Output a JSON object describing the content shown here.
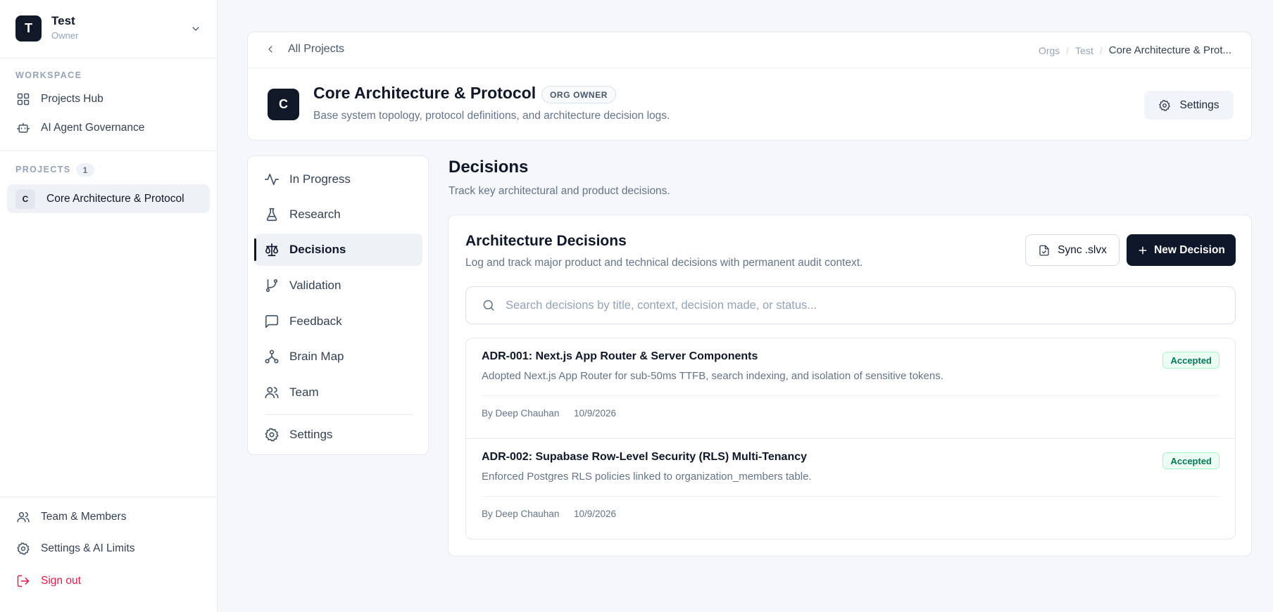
{
  "org": {
    "avatar": "T",
    "name": "Test",
    "role": "Owner"
  },
  "sidebar": {
    "workspace_label": "WORKSPACE",
    "workspace_items": [
      {
        "label": "Projects Hub",
        "icon": "grid-icon"
      },
      {
        "label": "AI Agent Governance",
        "icon": "bot-icon"
      }
    ],
    "projects_label": "PROJECTS",
    "projects_count": "1",
    "projects": [
      {
        "initial": "C",
        "label": "Core Architecture & Protocol"
      }
    ],
    "footer_items": [
      {
        "label": "Team & Members",
        "icon": "users-icon"
      },
      {
        "label": "Settings & AI Limits",
        "icon": "gear-icon"
      },
      {
        "label": "Sign out",
        "icon": "sign-out-icon"
      }
    ]
  },
  "header": {
    "back_label": "All Projects",
    "breadcrumbs": [
      "Orgs",
      "Test",
      "Core Architecture & Prot..."
    ],
    "breadcrumb_separator": "/",
    "project_initial": "C",
    "project_title": "Core Architecture & Protocol",
    "role_badge": "ORG OWNER",
    "project_description": "Base system topology, protocol definitions, and architecture decision logs.",
    "settings_label": "Settings"
  },
  "subnav": {
    "items": [
      {
        "label": "In Progress",
        "icon": "activity-icon"
      },
      {
        "label": "Research",
        "icon": "flask-icon"
      },
      {
        "label": "Decisions",
        "icon": "scale-icon",
        "active": true
      },
      {
        "label": "Validation",
        "icon": "git-branch-icon"
      },
      {
        "label": "Feedback",
        "icon": "message-square-icon"
      },
      {
        "label": "Brain Map",
        "icon": "network-icon"
      },
      {
        "label": "Team",
        "icon": "users-icon"
      },
      {
        "label": "Settings",
        "icon": "gear-icon"
      }
    ]
  },
  "main": {
    "title": "Decisions",
    "subtitle": "Track key architectural and product decisions.",
    "card": {
      "title": "Architecture Decisions",
      "subtitle": "Log and track major product and technical decisions with permanent audit context.",
      "sync_label": "Sync .slvx",
      "new_label": "New Decision",
      "search_placeholder": "Search decisions by title, context, decision made, or status...",
      "search_value": ""
    },
    "decisions": [
      {
        "title": "ADR-001: Next.js App Router & Server Components",
        "description": "Adopted Next.js App Router for sub-50ms TTFB, search indexing, and isolation of sensitive tokens.",
        "author": "By Deep Chauhan",
        "date": "10/9/2026",
        "status": "Accepted"
      },
      {
        "title": "ADR-002: Supabase Row-Level Security (RLS) Multi-Tenancy",
        "description": "Enforced Postgres RLS policies linked to organization_members table.",
        "author": "By Deep Chauhan",
        "date": "10/9/2026",
        "status": "Accepted"
      }
    ]
  },
  "colors": {
    "accent": "#0f172a",
    "danger": "#e11d48",
    "success": "#047857"
  }
}
